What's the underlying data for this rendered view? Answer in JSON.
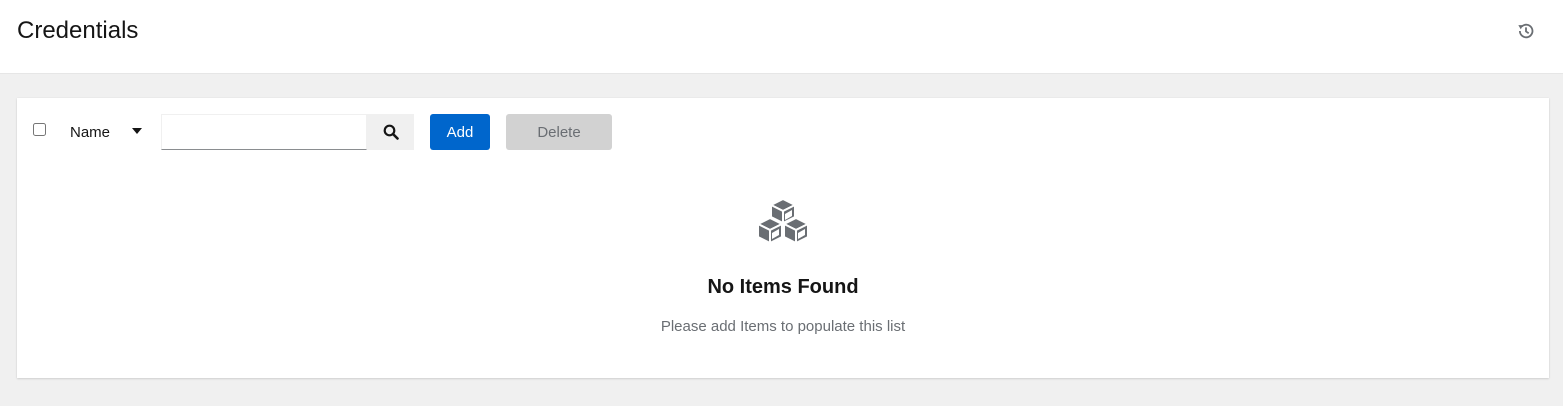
{
  "header": {
    "title": "Credentials",
    "history_icon": "history-icon"
  },
  "toolbar": {
    "filter_label": "Name",
    "search_value": "",
    "search_placeholder": "",
    "search_icon": "search-icon",
    "add_label": "Add",
    "delete_label": "Delete"
  },
  "empty_state": {
    "icon": "cubes-icon",
    "title": "No Items Found",
    "body": "Please add Items to populate this list"
  },
  "colors": {
    "primary": "#0066cc",
    "disabled_bg": "#d2d2d2",
    "page_bg": "#f0f0f0",
    "icon_gray": "#6a6e73"
  }
}
